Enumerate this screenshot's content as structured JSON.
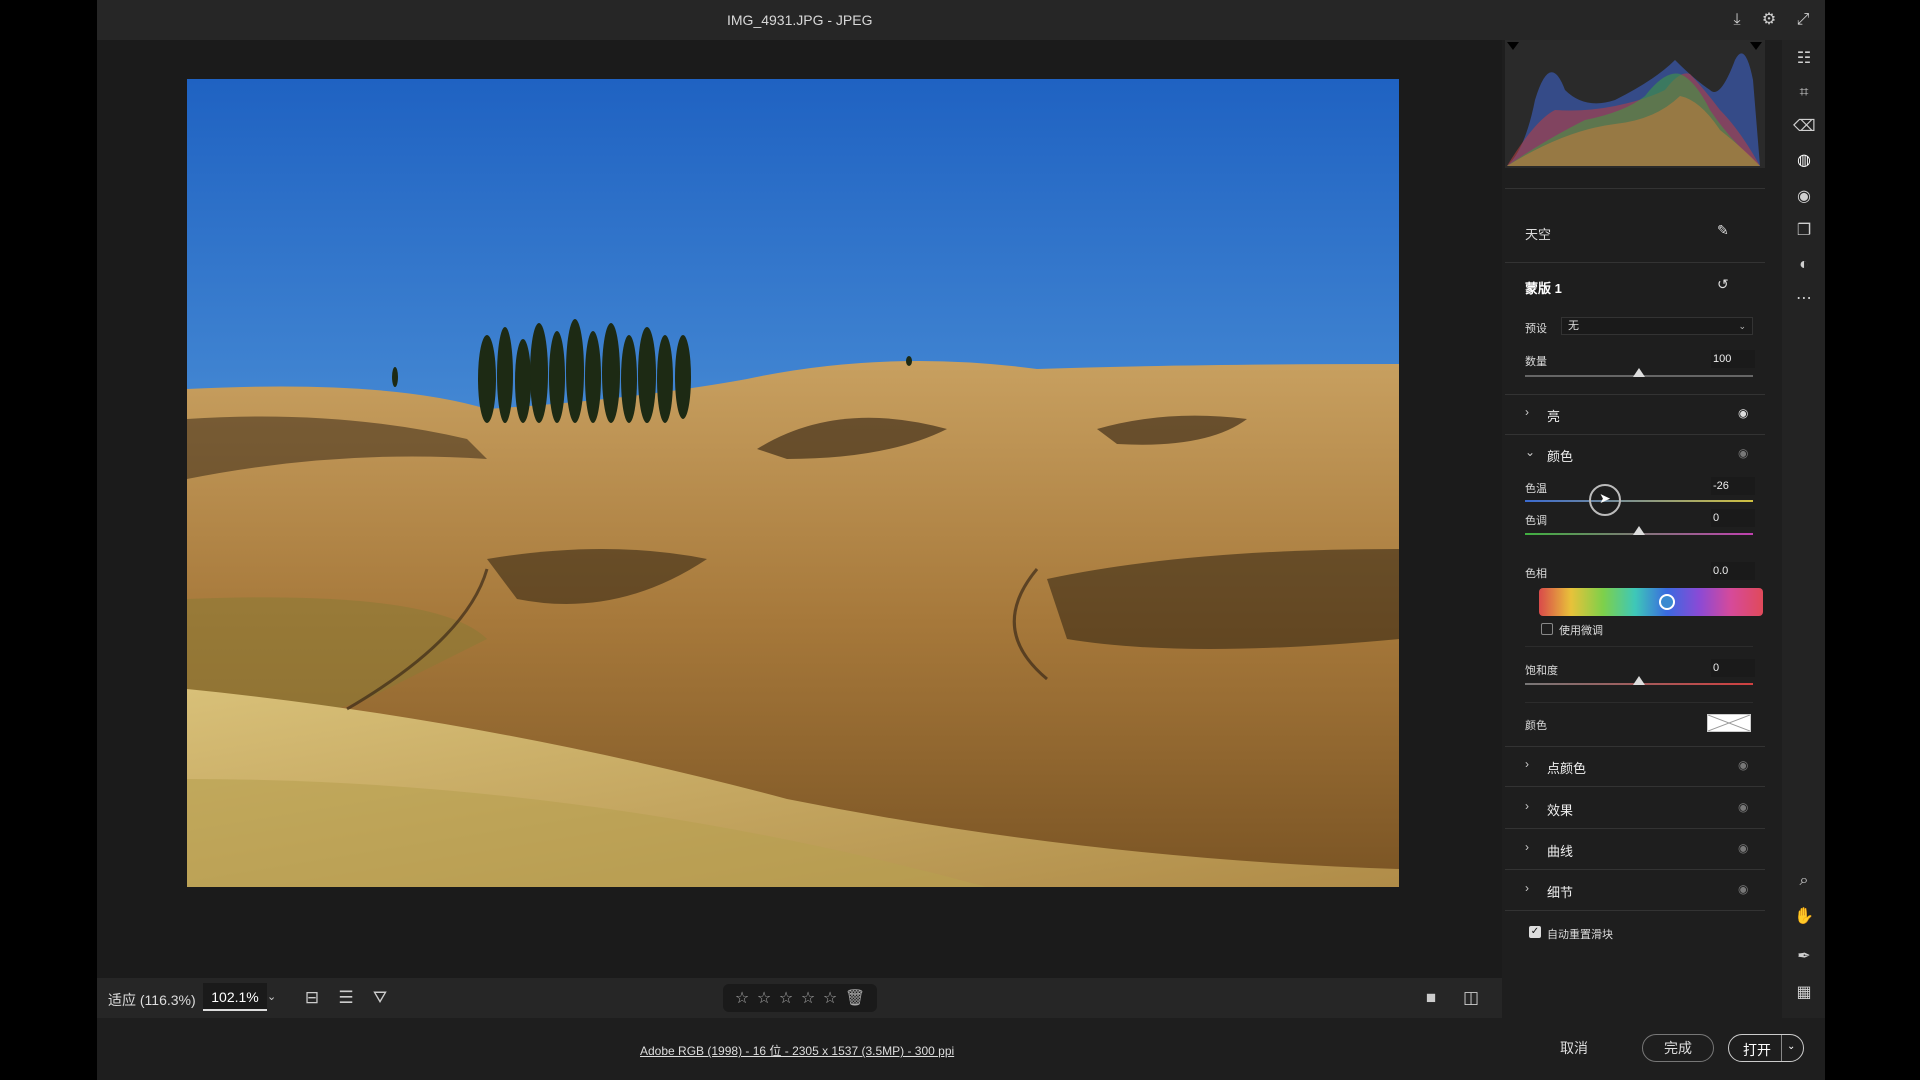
{
  "window": {
    "title": "IMG_4931.JPG -  JPEG"
  },
  "bottom": {
    "fit_label": "适应 (116.3%)",
    "zoom_value": "102.1%",
    "stars": [
      "☆",
      "☆",
      "☆",
      "☆",
      "☆"
    ],
    "delete_icon": "trash-icon"
  },
  "footer": {
    "info": "Adobe RGB (1998) - 16 位 - 2305 x 1537 (3.5MP) - 300 ppi",
    "cancel": "取消",
    "done": "完成",
    "open": "打开"
  },
  "panel": {
    "mask_group": "天空",
    "mask_name": "蒙版 1",
    "preset_label": "预设",
    "preset_value": "无",
    "amount_label": "数量",
    "amount_value": "100",
    "sections": {
      "light": "亮",
      "color": "颜色",
      "point_color": "点颜色",
      "effects": "效果",
      "curve": "曲线",
      "detail": "细节"
    },
    "temp_label": "色温",
    "temp_value": "-26",
    "tint_label": "色调",
    "tint_value": "0",
    "hue_label": "色相",
    "hue_value": "0.0",
    "fine_adjust_label": "使用微调",
    "saturation_label": "饱和度",
    "saturation_value": "0",
    "color_label": "颜色",
    "auto_reset_label": "自动重置滑块"
  },
  "colors": {
    "accent": "#3a8ad0",
    "panel_bg": "#1e1e1e",
    "sky": "#2a6fc4"
  }
}
